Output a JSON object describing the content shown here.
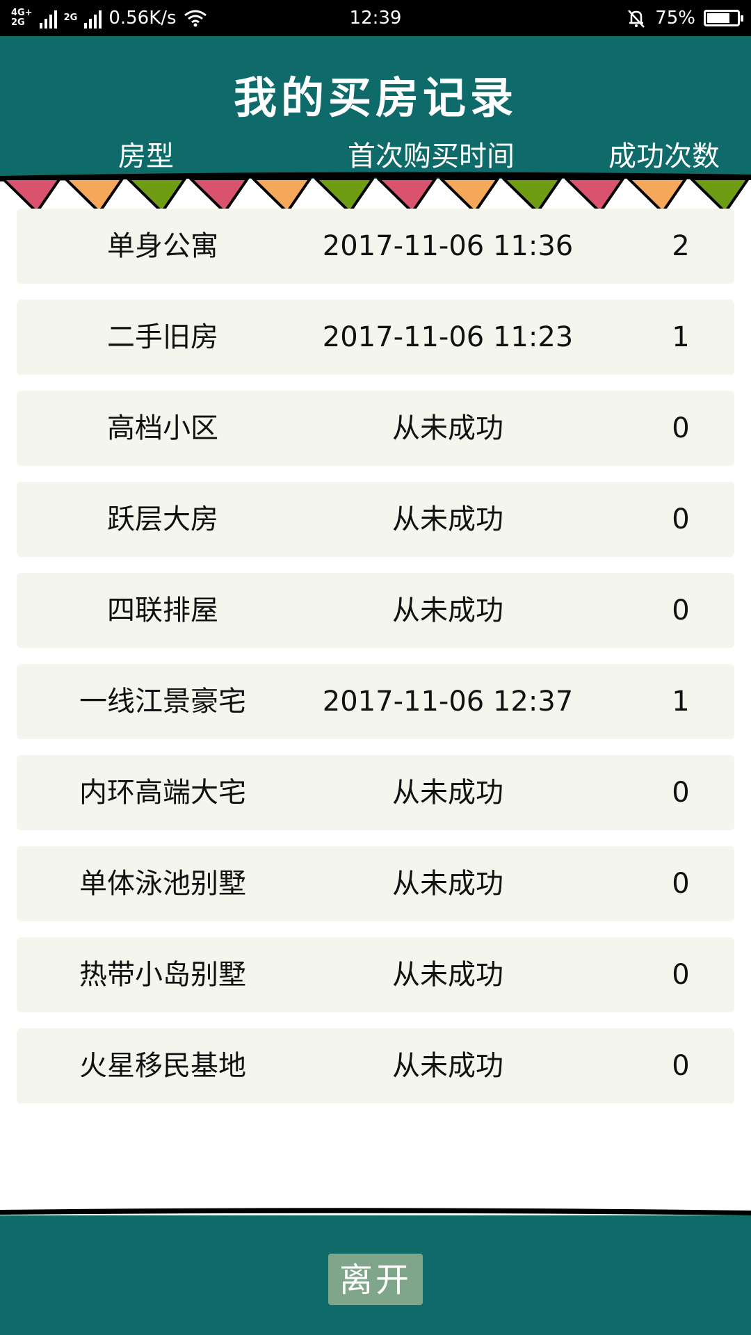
{
  "status_bar": {
    "network": "4G+\n2G",
    "network2": "2G",
    "speed": "0.56K/s",
    "time": "12:39",
    "battery_percent": "75%",
    "battery_level": 0.75
  },
  "header": {
    "title": "我的买房记录",
    "columns": [
      "房型",
      "首次购买时间",
      "成功次数"
    ]
  },
  "colors": {
    "header_bg": "#0f6a6a",
    "row_bg": "#f4f6ee",
    "pennant_pink": "#d9536f",
    "pennant_orange": "#f6a85a",
    "pennant_green": "#6e9d13",
    "button_bg": "#7fa58a"
  },
  "rows": [
    {
      "type": "单身公寓",
      "first_time": "2017-11-06 11:36",
      "count": "2"
    },
    {
      "type": "二手旧房",
      "first_time": "2017-11-06 11:23",
      "count": "1"
    },
    {
      "type": "高档小区",
      "first_time": "从未成功",
      "count": "0"
    },
    {
      "type": "跃层大房",
      "first_time": "从未成功",
      "count": "0"
    },
    {
      "type": "四联排屋",
      "first_time": "从未成功",
      "count": "0"
    },
    {
      "type": "一线江景豪宅",
      "first_time": "2017-11-06 12:37",
      "count": "1"
    },
    {
      "type": "内环高端大宅",
      "first_time": "从未成功",
      "count": "0"
    },
    {
      "type": "单体泳池别墅",
      "first_time": "从未成功",
      "count": "0"
    },
    {
      "type": "热带小岛别墅",
      "first_time": "从未成功",
      "count": "0"
    },
    {
      "type": "火星移民基地",
      "first_time": "从未成功",
      "count": "0"
    }
  ],
  "footer": {
    "leave_label": "离开"
  }
}
